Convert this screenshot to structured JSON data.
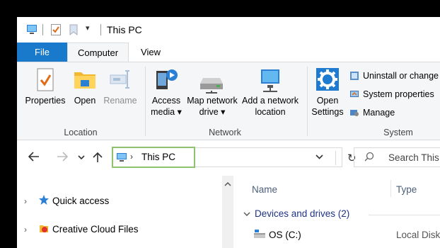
{
  "title_bar": {
    "title": "This PC",
    "quick_access": [
      "this-pc-icon",
      "properties-check-icon",
      "new-folder-icon",
      "customize-dropdown-icon"
    ]
  },
  "tabs": [
    {
      "label": "File"
    },
    {
      "label": "Computer"
    },
    {
      "label": "View"
    }
  ],
  "ribbon": {
    "location": {
      "group_label": "Location",
      "buttons": [
        {
          "label": "Properties",
          "icon": "properties-icon",
          "enabled": true
        },
        {
          "label": "Open",
          "icon": "open-folder-icon",
          "enabled": true
        },
        {
          "label": "Rename",
          "icon": "rename-icon",
          "enabled": false
        }
      ]
    },
    "network": {
      "group_label": "Network",
      "buttons": [
        {
          "line1": "Access",
          "line2": "media ▾",
          "icon": "access-media-icon"
        },
        {
          "line1": "Map network",
          "line2": "drive ▾",
          "icon": "map-network-drive-icon"
        },
        {
          "line1": "Add a network",
          "line2": "location",
          "icon": "add-network-location-icon"
        }
      ]
    },
    "system": {
      "group_label": "System",
      "open_settings": {
        "line1": "Open",
        "line2": "Settings",
        "icon": "gear-icon"
      },
      "small": [
        {
          "label": "Uninstall or change",
          "icon": "uninstall-icon"
        },
        {
          "label": "System properties",
          "icon": "system-properties-icon"
        },
        {
          "label": "Manage",
          "icon": "manage-icon"
        }
      ]
    }
  },
  "address": {
    "path": "This PC",
    "search_placeholder": "Search This"
  },
  "nav_pane": {
    "items": [
      {
        "label": "Quick access",
        "icon": "star-icon"
      },
      {
        "label": "Creative Cloud Files",
        "icon": "creative-cloud-icon"
      }
    ]
  },
  "content": {
    "columns": [
      "Name",
      "Type"
    ],
    "group": "Devices and drives (2)",
    "rows": [
      {
        "name": "OS (C:)",
        "type": "Local Disk"
      }
    ]
  },
  "colors": {
    "accent": "#1979ca",
    "address_highlight": "#8dc26f",
    "group_header": "#1e3287"
  }
}
